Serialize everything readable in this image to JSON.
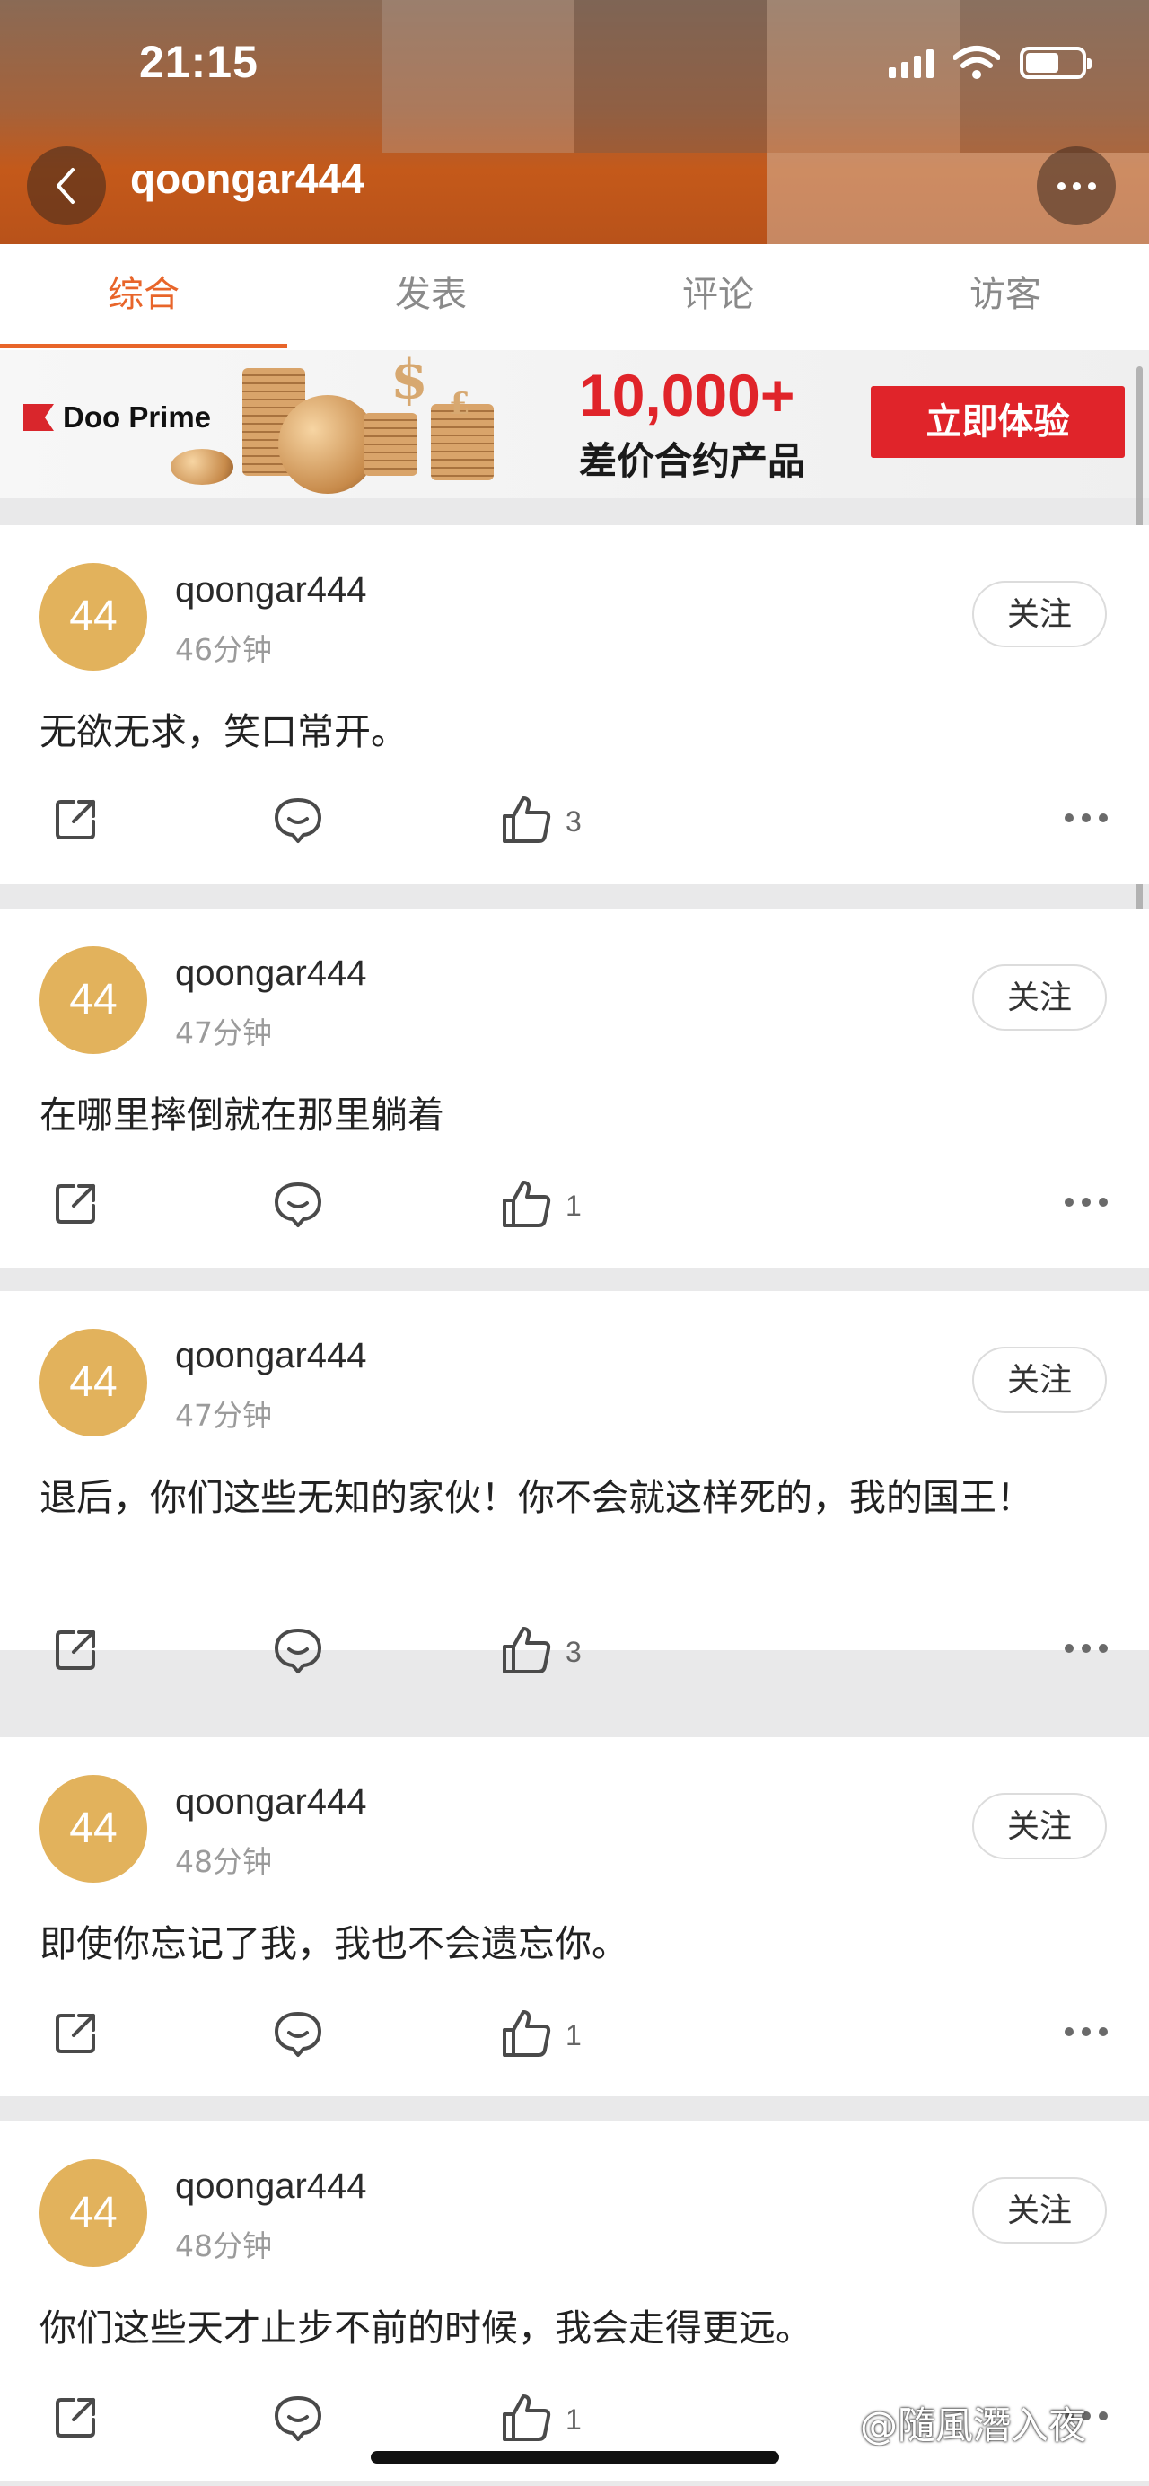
{
  "status_bar": {
    "time": "21:15"
  },
  "nav": {
    "title": "qoongar444"
  },
  "tabs": [
    {
      "label": "综合",
      "active": true
    },
    {
      "label": "发表",
      "active": false
    },
    {
      "label": "评论",
      "active": false
    },
    {
      "label": "访客",
      "active": false
    }
  ],
  "ad": {
    "brand": "Doo Prime",
    "headline": "10,000+",
    "subline": "差价合约产品",
    "cta": "立即体验"
  },
  "posts": [
    {
      "avatar_text": "44",
      "username": "qoongar444",
      "time": "46分钟",
      "follow": "关注",
      "content": "无欲无求，笑口常开。",
      "likes": "3"
    },
    {
      "avatar_text": "44",
      "username": "qoongar444",
      "time": "47分钟",
      "follow": "关注",
      "content": "在哪里摔倒就在那里躺着",
      "likes": "1"
    },
    {
      "avatar_text": "44",
      "username": "qoongar444",
      "time": "47分钟",
      "follow": "关注",
      "content": "退后，你们这些无知的家伙！你不会就这样死的，我的国王！",
      "likes": "3"
    },
    {
      "avatar_text": "44",
      "username": "qoongar444",
      "time": "48分钟",
      "follow": "关注",
      "content": "即使你忘记了我，我也不会遗忘你。",
      "likes": "1"
    },
    {
      "avatar_text": "44",
      "username": "qoongar444",
      "time": "48分钟",
      "follow": "关注",
      "content": "你们这些天才止步不前的时候，我会走得更远。",
      "likes": "1"
    }
  ],
  "watermark": "@隨風潛入夜",
  "colors": {
    "accent": "#e8652a",
    "avatar": "#e2b25c",
    "ad_red": "#e0242a"
  }
}
